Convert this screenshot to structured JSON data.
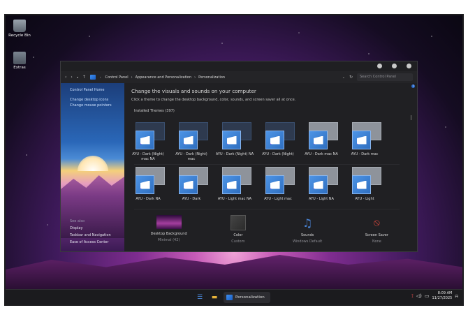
{
  "desktop": {
    "icons": [
      {
        "label": "Recycle Bin"
      },
      {
        "label": "Extras"
      }
    ]
  },
  "window": {
    "address": {
      "crumbs": [
        "Control Panel",
        "Appearance and Personalization",
        "Personalization"
      ],
      "search_placeholder": "Search Control Panel"
    },
    "sidebar": {
      "links": [
        "Control Panel Home",
        "Change desktop icons",
        "Change mouse pointers"
      ],
      "see_also_heading": "See also",
      "see_also": [
        "Display",
        "Taskbar and Navigation",
        "Ease of Access Center"
      ]
    },
    "main": {
      "heading": "Change the visuals and sounds on your computer",
      "subheading": "Click a theme to change the desktop background, color, sounds, and screen saver all at once.",
      "installed_label": "Installed Themes (397)",
      "themes": [
        {
          "name": "AYU - Dark (Night) mac NA",
          "style": "dark"
        },
        {
          "name": "AYU - Dark (Night) mac",
          "style": "dark"
        },
        {
          "name": "AYU - Dark (Night) NA",
          "style": "dark"
        },
        {
          "name": "AYU - Dark (Night)",
          "style": "dark"
        },
        {
          "name": "AYU - Dark mac NA",
          "style": "light"
        },
        {
          "name": "AYU - Dark mac",
          "style": "light"
        },
        {
          "name": "AYU - Dark NA",
          "style": "light"
        },
        {
          "name": "AYU - Dark",
          "style": "light"
        },
        {
          "name": "AYU - Light mac NA",
          "style": "light"
        },
        {
          "name": "AYU - Light mac",
          "style": "light"
        },
        {
          "name": "AYU - Light NA",
          "style": "light"
        },
        {
          "name": "AYU - Light",
          "style": "light"
        }
      ],
      "bottom": [
        {
          "label": "Desktop Background",
          "value": "Minimal (42)"
        },
        {
          "label": "Color",
          "value": "Custom"
        },
        {
          "label": "Sounds",
          "value": "Windows Default"
        },
        {
          "label": "Screen Saver",
          "value": "None"
        }
      ]
    }
  },
  "taskbar": {
    "app_label": "Personalization",
    "time": "8:09 AM",
    "date": "11/27/2025"
  },
  "colors": {
    "accent": "#2f6fc0",
    "window_bg": "#202023",
    "taskbar_bg": "#1b1b1e"
  }
}
